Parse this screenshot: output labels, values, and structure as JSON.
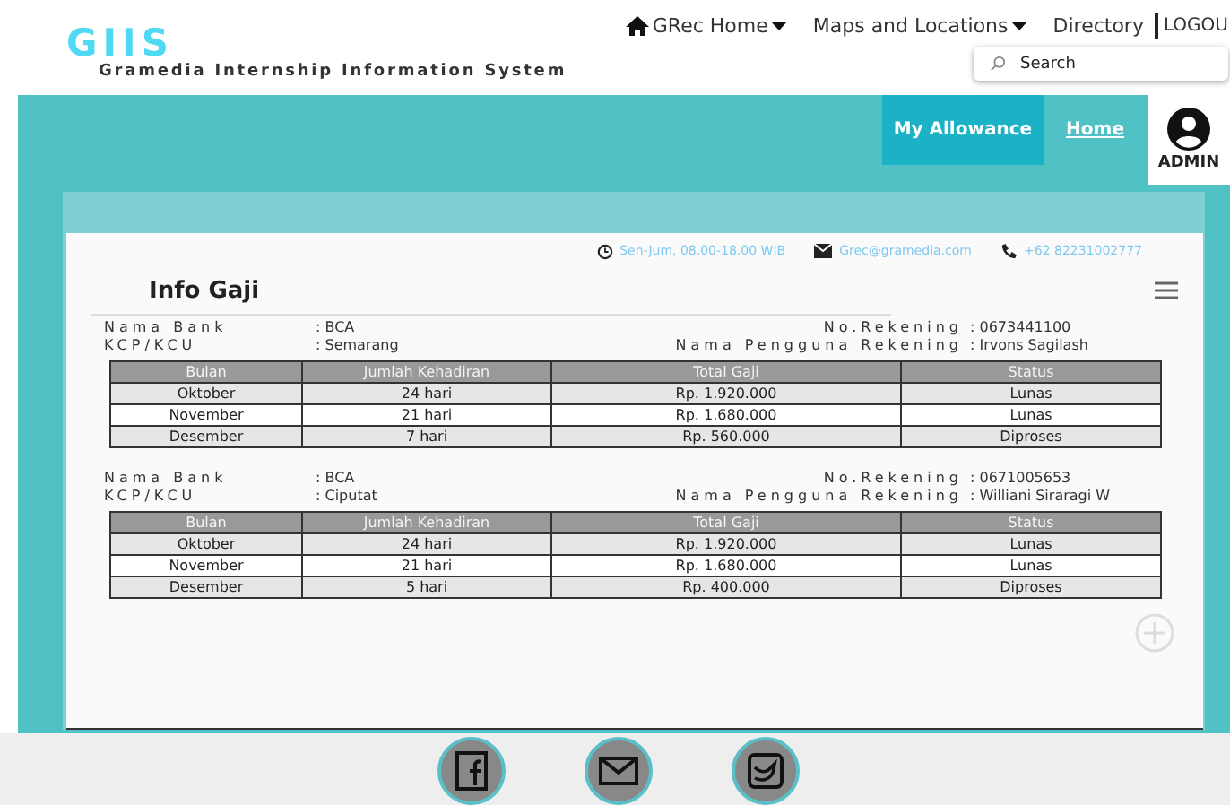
{
  "logo": {
    "mark": "GIIS",
    "subtitle": "Gramedia Internship Information System"
  },
  "nav": [
    {
      "kind": "home",
      "label": "GRec Home",
      "dropdown": true
    },
    {
      "kind": "link",
      "label": "Maps and Locations",
      "dropdown": true
    },
    {
      "kind": "link",
      "label": "Directory",
      "dropdown": false
    }
  ],
  "logout": "LOGOU",
  "search": {
    "placeholder": "Search"
  },
  "menu": [
    {
      "label": "My Allowance",
      "selected": true
    },
    {
      "label": "Home",
      "selected": false
    }
  ],
  "user": {
    "name": "ADMIN"
  },
  "contact": [
    {
      "kind": "clock",
      "text": "Sen-Jum, 08.00-18.00 WIB"
    },
    {
      "kind": "mail",
      "text": "Grec@gramedia.com"
    },
    {
      "kind": "phone",
      "text": "+62 82231002777"
    }
  ],
  "title": "Info Gaji",
  "accounts": [
    {
      "bank_label": "Nama Bank",
      "bank": ": BCA",
      "branch_label": "KCP/KCU",
      "branch": ": Semarang",
      "number_label": "No.Rekening",
      "number": ": 0673441100",
      "owner_label": "Nama Pengguna Rekening",
      "owner": ": Irvons Sagilash",
      "columns": [
        "Bulan",
        "Jumlah Kehadiran",
        "Total Gaji",
        "Status"
      ],
      "rows": [
        [
          "Oktober",
          "24 hari",
          "Rp. 1.920.000",
          "Lunas"
        ],
        [
          "November",
          "21 hari",
          "Rp. 1.680.000",
          "Lunas"
        ],
        [
          "Desember",
          "7 hari",
          "Rp. 560.000",
          "Diproses"
        ]
      ]
    },
    {
      "bank_label": "Nama Bank",
      "bank": ": BCA",
      "branch_label": "KCP/KCU",
      "branch": ": Ciputat",
      "number_label": "No.Rekening",
      "number": ": 0671005653",
      "owner_label": "Nama Pengguna Rekening",
      "owner": ": Williani Siraragi W",
      "columns": [
        "Bulan",
        "Jumlah Kehadiran",
        "Total Gaji",
        "Status"
      ],
      "rows": [
        [
          "Oktober",
          "24 hari",
          "Rp. 1.920.000",
          "Lunas"
        ],
        [
          "November",
          "21 hari",
          "Rp. 1.680.000",
          "Lunas"
        ],
        [
          "Desember",
          "5 hari",
          "Rp. 400.000",
          "Diproses"
        ]
      ]
    }
  ],
  "social": [
    {
      "kind": "facebook"
    },
    {
      "kind": "mail"
    },
    {
      "kind": "twitter"
    }
  ]
}
